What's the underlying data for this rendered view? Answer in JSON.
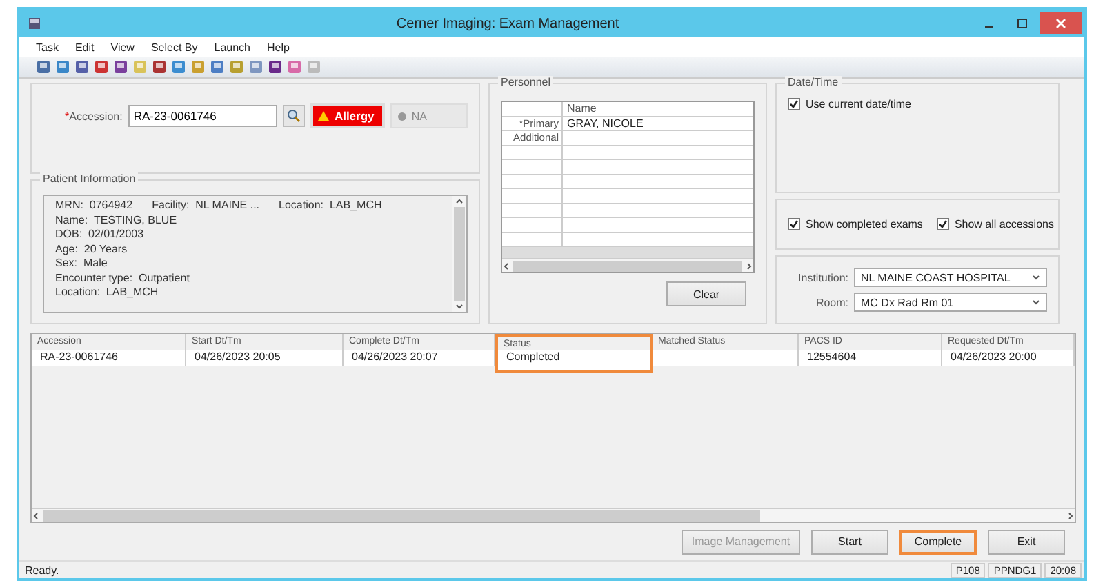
{
  "window": {
    "title": "Cerner Imaging: Exam Management"
  },
  "menu": [
    "Task",
    "Edit",
    "View",
    "Select By",
    "Launch",
    "Help"
  ],
  "accession": {
    "label": "Accession:",
    "required_mark": "*",
    "value": "RA-23-0061746",
    "allergy": "Allergy",
    "na": "NA"
  },
  "patient_info": {
    "title": "Patient Information",
    "lines": [
      [
        {
          "label": "MRN:",
          "value": "0764942"
        },
        {
          "label": "Facility:",
          "value": "NL MAINE ..."
        },
        {
          "label": "Location:",
          "value": "LAB_MCH"
        }
      ],
      [
        {
          "label": "Name:",
          "value": "TESTING, BLUE"
        }
      ],
      [
        {
          "label": "DOB:",
          "value": "02/01/2003"
        }
      ],
      [
        {
          "label": "Age:",
          "value": "20 Years"
        }
      ],
      [
        {
          "label": "Sex:",
          "value": "Male"
        }
      ],
      [
        {
          "label": "Encounter type:",
          "value": "Outpatient"
        }
      ],
      [
        {
          "label": "Location:",
          "value": "LAB_MCH"
        }
      ]
    ]
  },
  "personnel": {
    "title": "Personnel",
    "column": "Name",
    "rows": [
      {
        "role": "*Primary",
        "name": "GRAY, NICOLE"
      },
      {
        "role": "Additional"
      }
    ],
    "clear": "Clear"
  },
  "datetime": {
    "title": "Date/Time",
    "use_current": {
      "label": "Use current date/time",
      "checked": true
    }
  },
  "filters": [
    {
      "label": "Show completed exams",
      "checked": true
    },
    {
      "label": "Show all accessions",
      "checked": true
    }
  ],
  "institution": {
    "label": "Institution:",
    "value": "NL MAINE COAST HOSPITAL"
  },
  "room": {
    "label": "Room:",
    "value": "MC Dx Rad Rm 01"
  },
  "table": {
    "columns": [
      {
        "label": "Accession",
        "highlighted": false
      },
      {
        "label": "Start Dt/Tm",
        "highlighted": false
      },
      {
        "label": "Complete Dt/Tm",
        "highlighted": false
      },
      {
        "label": "Status",
        "highlighted": true
      },
      {
        "label": "Matched Status",
        "highlighted": false
      },
      {
        "label": "PACS ID",
        "highlighted": false
      },
      {
        "label": "Requested Dt/Tm",
        "highlighted": false
      }
    ],
    "rows": [
      [
        "RA-23-0061746",
        "04/26/2023 20:05",
        "04/26/2023 20:07",
        "Completed",
        "",
        "12554604",
        "04/26/2023 20:00"
      ]
    ]
  },
  "buttons": [
    {
      "label": "Image Management",
      "disabled": true,
      "highlighted": false
    },
    {
      "label": "Start",
      "disabled": false,
      "highlighted": false
    },
    {
      "label": "Complete",
      "disabled": false,
      "highlighted": true
    },
    {
      "label": "Exit",
      "disabled": false,
      "highlighted": false
    }
  ],
  "status_bar": {
    "text": "Ready.",
    "panes": [
      "P108",
      "PPNDG1",
      "20:08"
    ]
  }
}
